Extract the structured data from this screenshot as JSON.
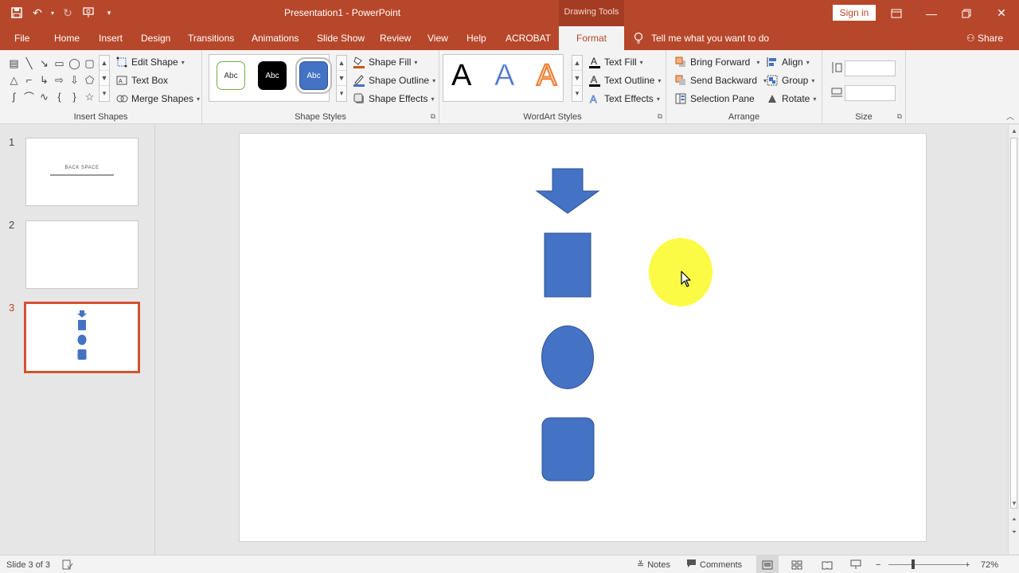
{
  "app": {
    "title": "Presentation1  -  PowerPoint",
    "context_group": "Drawing Tools",
    "sign_in": "Sign in",
    "share": "Share",
    "tell_me": "Tell me what you want to do"
  },
  "tabs": [
    "File",
    "Home",
    "Insert",
    "Design",
    "Transitions",
    "Animations",
    "Slide Show",
    "Review",
    "View",
    "Help",
    "ACROBAT",
    "Format"
  ],
  "active_tab": "Format",
  "ribbon": {
    "insert_shapes": {
      "label": "Insert Shapes",
      "edit_shape": "Edit Shape",
      "text_box": "Text Box",
      "merge_shapes": "Merge Shapes"
    },
    "shape_styles": {
      "label": "Shape Styles",
      "swatch_text": "Abc",
      "shape_fill": "Shape Fill",
      "shape_outline": "Shape Outline",
      "shape_effects": "Shape Effects"
    },
    "wordart_styles": {
      "label": "WordArt Styles",
      "letter": "A",
      "text_fill": "Text Fill",
      "text_outline": "Text Outline",
      "text_effects": "Text Effects"
    },
    "arrange": {
      "label": "Arrange",
      "bring_forward": "Bring Forward",
      "send_backward": "Send Backward",
      "selection_pane": "Selection Pane",
      "align": "Align",
      "group": "Group",
      "rotate": "Rotate"
    },
    "size": {
      "label": "Size"
    }
  },
  "slides": [
    {
      "number": "1",
      "title": "BACK SPACE"
    },
    {
      "number": "2"
    },
    {
      "number": "3"
    }
  ],
  "status": {
    "slide_of": "Slide 3 of 3",
    "notes": "Notes",
    "comments": "Comments",
    "zoom": "72%"
  },
  "colors": {
    "accent": "#b7472a",
    "shape_fill": "#4472c4",
    "shape_stroke": "#2f528f",
    "cursor_highlight": "#fbfb3c"
  }
}
